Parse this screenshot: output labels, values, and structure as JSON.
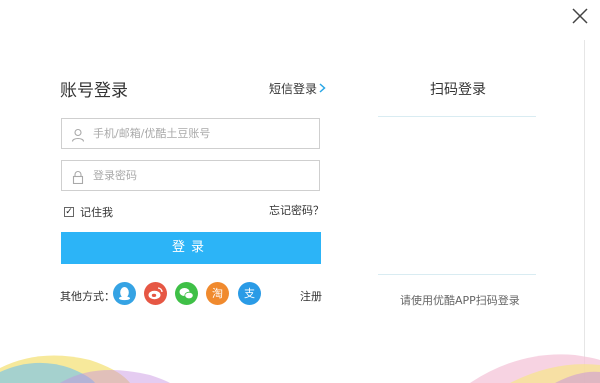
{
  "login": {
    "title": "账号登录",
    "sms_link": "短信登录",
    "account_placeholder": "手机/邮箱/优酷土豆账号",
    "password_placeholder": "登录密码",
    "remember_label": "记住我",
    "remember_checked": true,
    "forgot_link": "忘记密码？",
    "submit_label": "登录",
    "other_methods_label": "其他方式：",
    "register_link": "注册",
    "accent_color": "#2cb4f7"
  },
  "social": [
    {
      "name": "qq",
      "icon": "qq-penguin-icon"
    },
    {
      "name": "weibo",
      "icon": "weibo-icon"
    },
    {
      "name": "wechat",
      "icon": "wechat-icon"
    },
    {
      "name": "taobao",
      "icon": "taobao-icon",
      "glyph": "淘"
    },
    {
      "name": "alipay",
      "icon": "alipay-icon",
      "glyph": "支"
    }
  ],
  "qr": {
    "title": "扫码登录",
    "caption": "请使用优酷APP扫码登录"
  }
}
